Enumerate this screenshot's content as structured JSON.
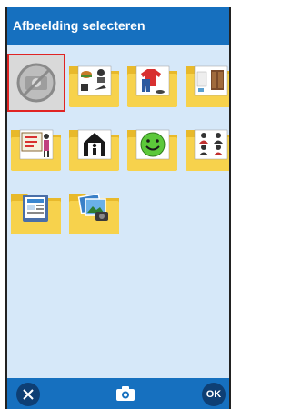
{
  "title": "Afbeelding selecteren",
  "colors": {
    "title_bar": "#1670bf",
    "background": "#d6e8f9",
    "folder": "#f7d24c",
    "selection": "#e02424",
    "button_dark": "#0e3f74"
  },
  "grid": {
    "items": [
      {
        "name": "no-image-tile",
        "icon": "no-photo-icon",
        "selected": true
      },
      {
        "name": "folder-food-care",
        "icon": "folder-food-care-icon",
        "selected": false
      },
      {
        "name": "folder-clothing",
        "icon": "folder-clothing-icon",
        "selected": false
      },
      {
        "name": "folder-furniture",
        "icon": "folder-furniture-icon",
        "selected": false
      },
      {
        "name": "folder-school",
        "icon": "folder-school-icon",
        "selected": false
      },
      {
        "name": "folder-house",
        "icon": "folder-house-icon",
        "selected": false
      },
      {
        "name": "folder-emotions",
        "icon": "folder-smiley-icon",
        "selected": false
      },
      {
        "name": "folder-people",
        "icon": "folder-people-icon",
        "selected": false
      },
      {
        "name": "folder-devices",
        "icon": "folder-tablet-icon",
        "selected": false
      },
      {
        "name": "folder-photos",
        "icon": "folder-camera-photos-icon",
        "selected": false
      }
    ]
  },
  "bottom_bar": {
    "close_icon": "close-icon",
    "camera_icon": "camera-icon",
    "ok_label": "OK"
  }
}
